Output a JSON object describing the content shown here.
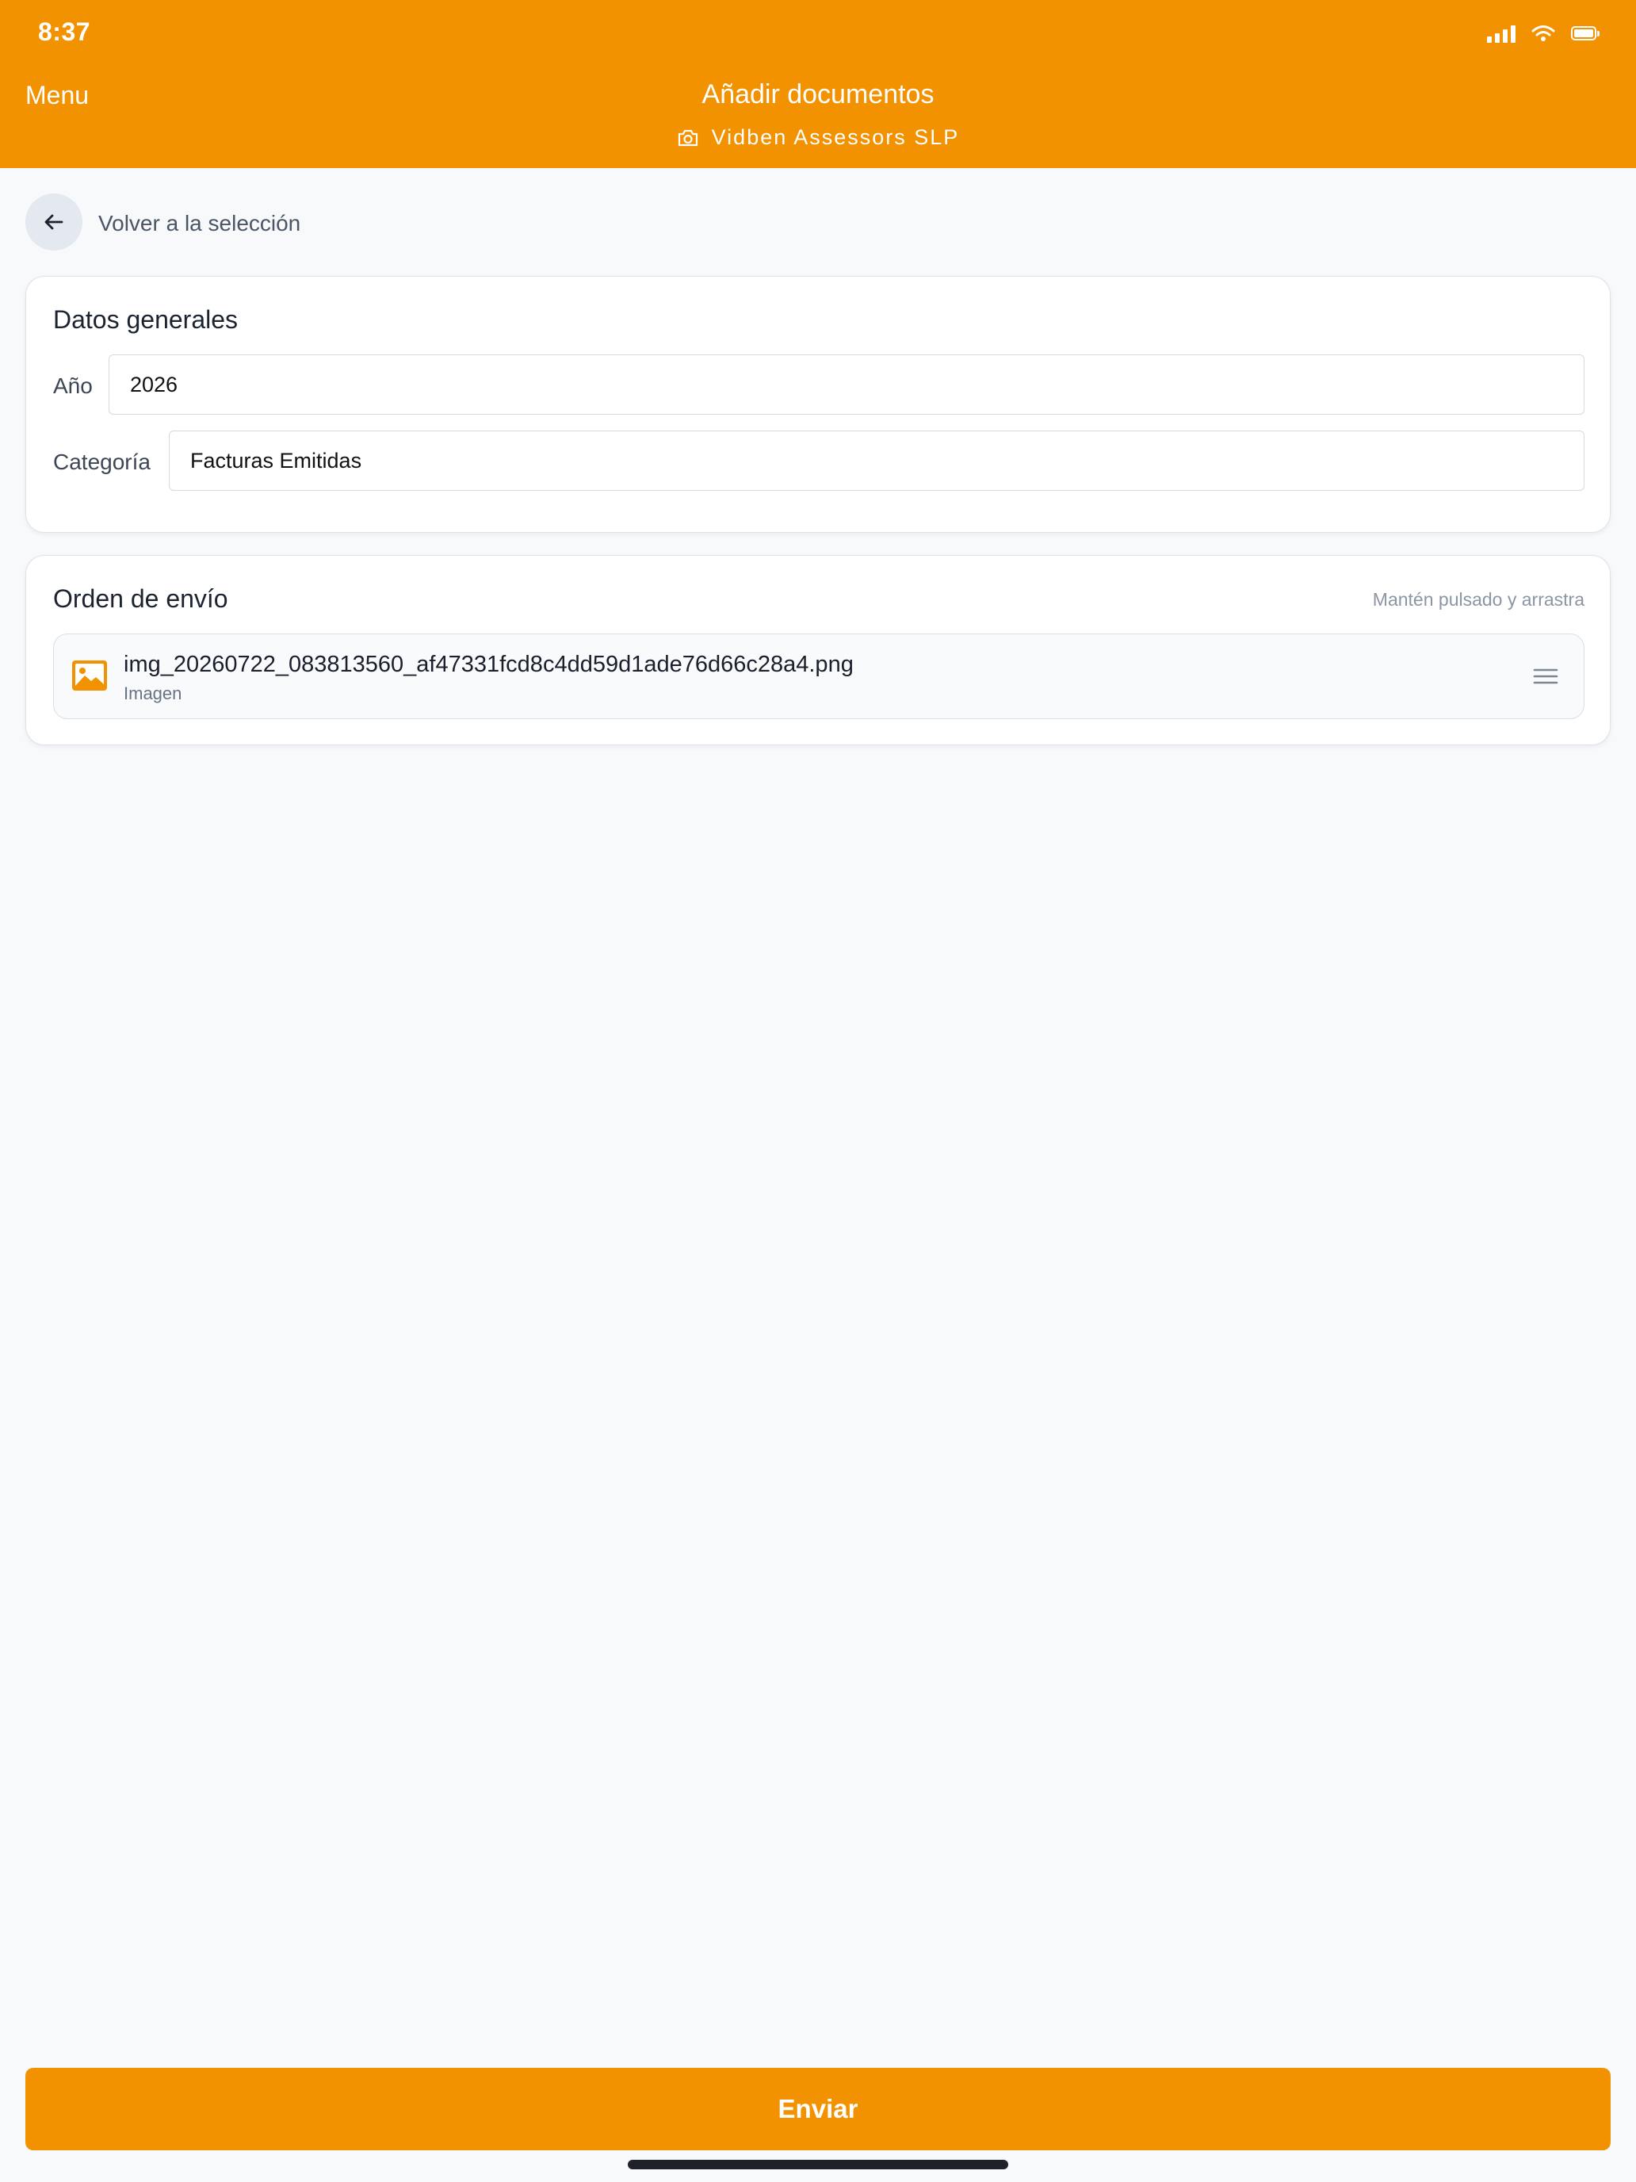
{
  "status_bar": {
    "time": "8:37"
  },
  "header": {
    "menu_label": "Menu",
    "title": "Añadir documentos",
    "subtitle": "Vidben Assessors SLP",
    "background_color": "#f39200"
  },
  "back": {
    "label": "Volver a la selección"
  },
  "general": {
    "title": "Datos generales",
    "year_label": "Año",
    "year_value": "2026",
    "category_label": "Categoría",
    "category_value": "Facturas Emitidas"
  },
  "order": {
    "title": "Orden de envío",
    "hint": "Mantén pulsado y arrastra",
    "files": [
      {
        "name": "img_20260722_083813560_af47331fcd8c4dd59d1ade76d66c28a4.png",
        "type": "Imagen",
        "icon": "image-icon"
      }
    ]
  },
  "submit": {
    "label": "Enviar"
  }
}
